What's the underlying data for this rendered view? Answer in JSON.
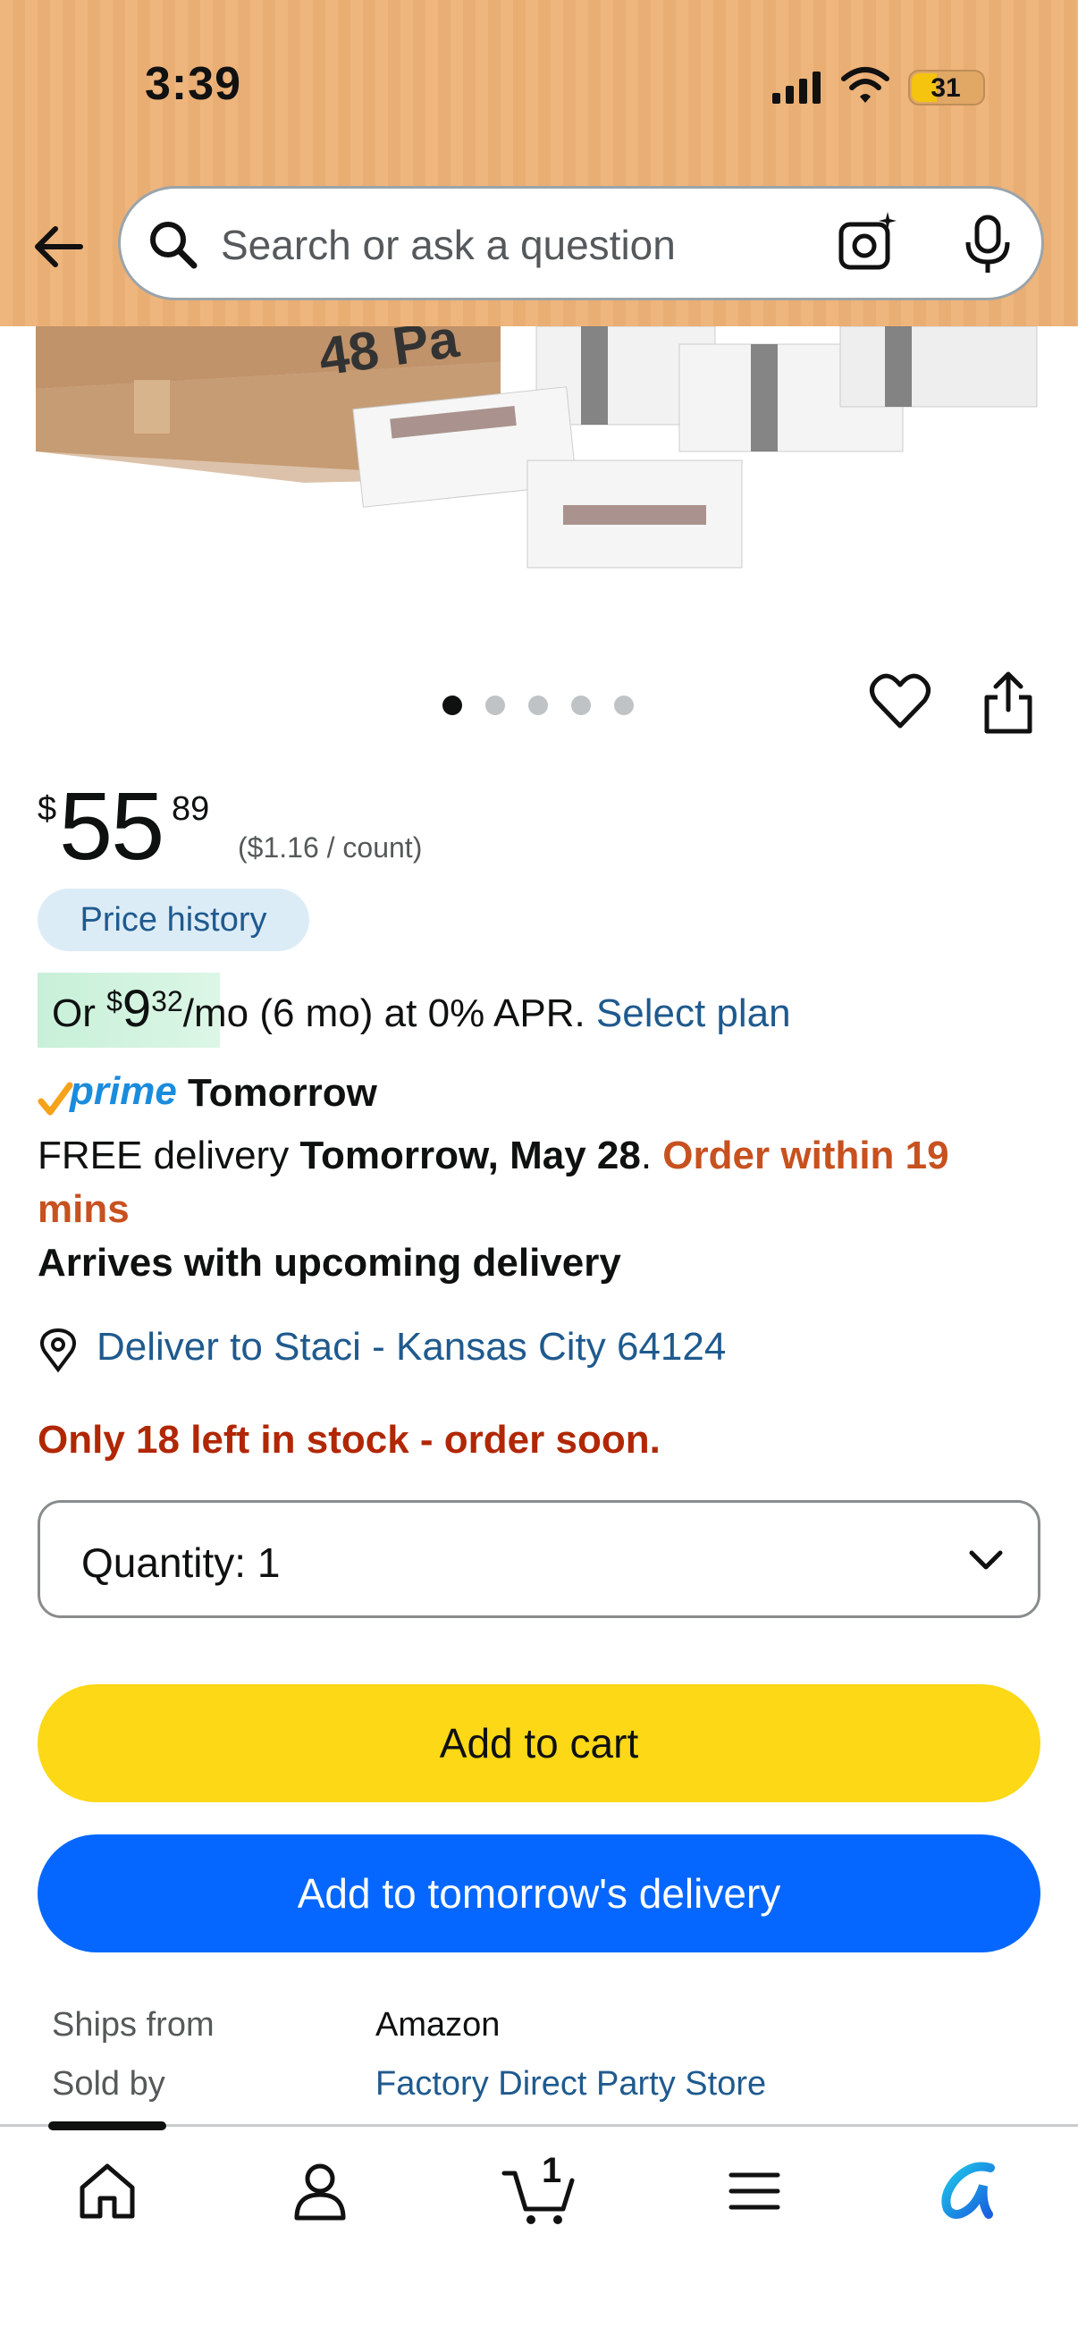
{
  "status_bar": {
    "time": "3:39",
    "battery": "31"
  },
  "search": {
    "placeholder": "Search or ask a question"
  },
  "carousel": {
    "dots": 5,
    "active_dot": 1
  },
  "price": {
    "currency_symbol": "$",
    "whole": "55",
    "fraction": "89",
    "unit_price": "($1.16 / count)"
  },
  "price_history_label": "Price history",
  "installment": {
    "prefix": "Or ",
    "currency_symbol": "$",
    "whole": "9",
    "fraction": "32",
    "suffix": "/mo (6 mo) at 0% APR. ",
    "link": "Select plan"
  },
  "prime": {
    "badge": "prime",
    "day": "Tomorrow"
  },
  "delivery": {
    "free_text": "FREE delivery ",
    "date": "Tomorrow, May 28",
    "separator": ". ",
    "order_within": "Order within 19",
    "order_within_cont": "mins",
    "arrives": "Arrives with upcoming delivery"
  },
  "deliver_to": "Deliver to Staci - Kansas City 64124",
  "stock": "Only 18 left in stock - order soon.",
  "quantity": {
    "label": "Quantity:",
    "value": "1"
  },
  "buttons": {
    "add_to_cart": "Add to cart",
    "add_tomorrow": "Add to tomorrow's delivery"
  },
  "seller": {
    "ships_from_label": "Ships from",
    "ships_from_value": "Amazon",
    "sold_by_label": "Sold by",
    "sold_by_value": "Factory Direct Party Store"
  },
  "product_image": {
    "box_text": "48 Pa"
  },
  "cart_count": "1",
  "colors": {
    "header_bg": "#eeb57c",
    "link": "#1f5a8e",
    "urgency_orange": "#c7511f",
    "stock_red": "#b12704",
    "add_to_cart_yellow": "#fcd816",
    "tomorrow_blue": "#0567ff",
    "prime_blue": "#1a8cde"
  },
  "icons": [
    "back-arrow-icon",
    "search-icon",
    "camera-icon",
    "mic-icon",
    "heart-icon",
    "share-icon",
    "location-pin-icon",
    "chevron-down-icon",
    "home-icon",
    "account-icon",
    "cart-icon",
    "menu-icon",
    "rufus-icon"
  ]
}
